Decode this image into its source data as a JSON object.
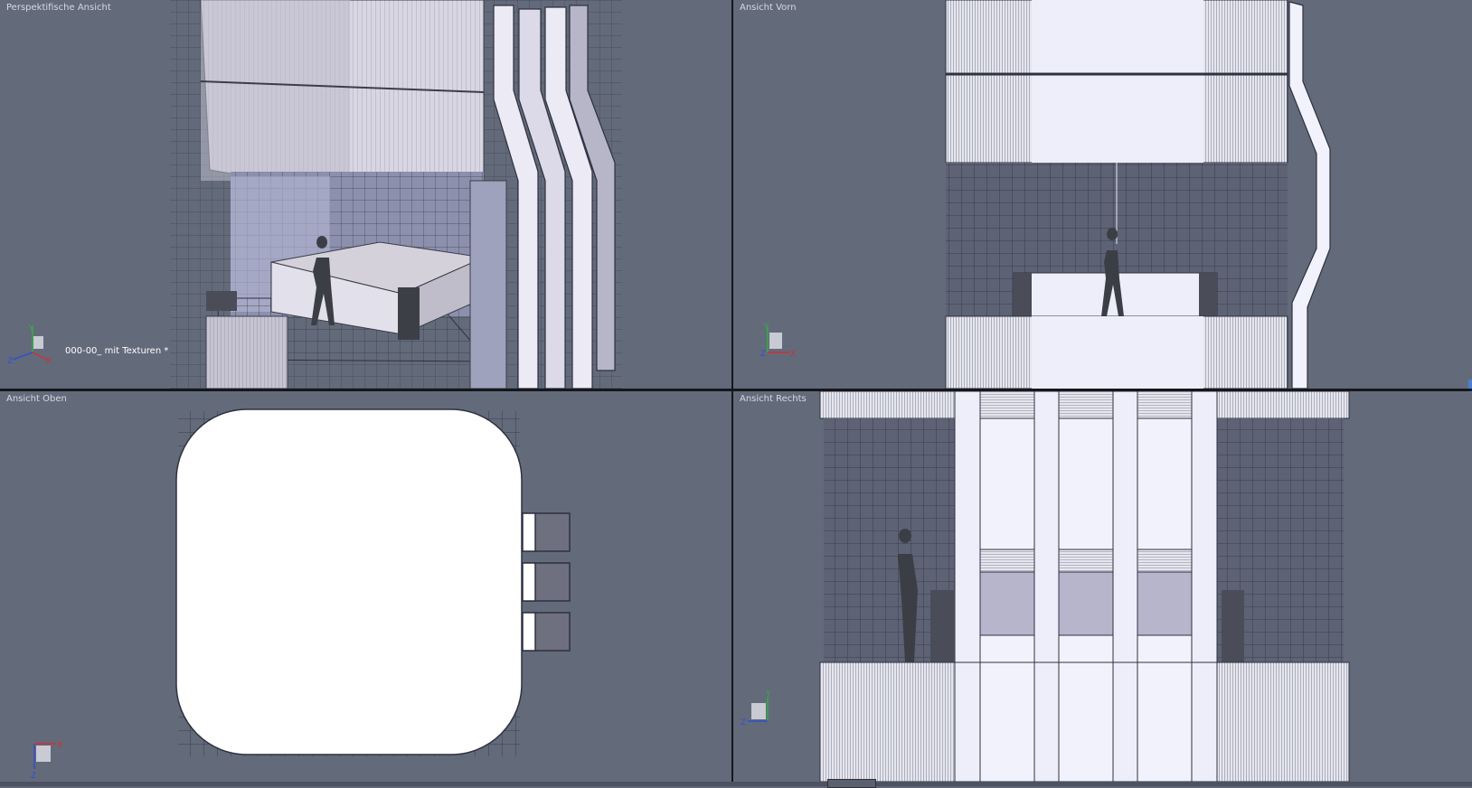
{
  "viewports": {
    "perspective": {
      "label": "Perspektifische Ansicht",
      "scene_name": "000-00_ mit Texturen *"
    },
    "front": {
      "label": "Ansicht Vorn"
    },
    "top": {
      "label": "Ansicht Oben"
    },
    "right": {
      "label": "Ansicht Rechts"
    }
  },
  "axes": {
    "x": "X",
    "y": "Y",
    "z": "Z"
  },
  "colors": {
    "viewport_bg": "#636a7a",
    "model_light": "#eeeefc",
    "model_shade": "#c9c9d6",
    "wire": "#2e3140",
    "axis_x": "#d23030",
    "axis_y": "#30b040",
    "axis_z": "#3050d0"
  }
}
